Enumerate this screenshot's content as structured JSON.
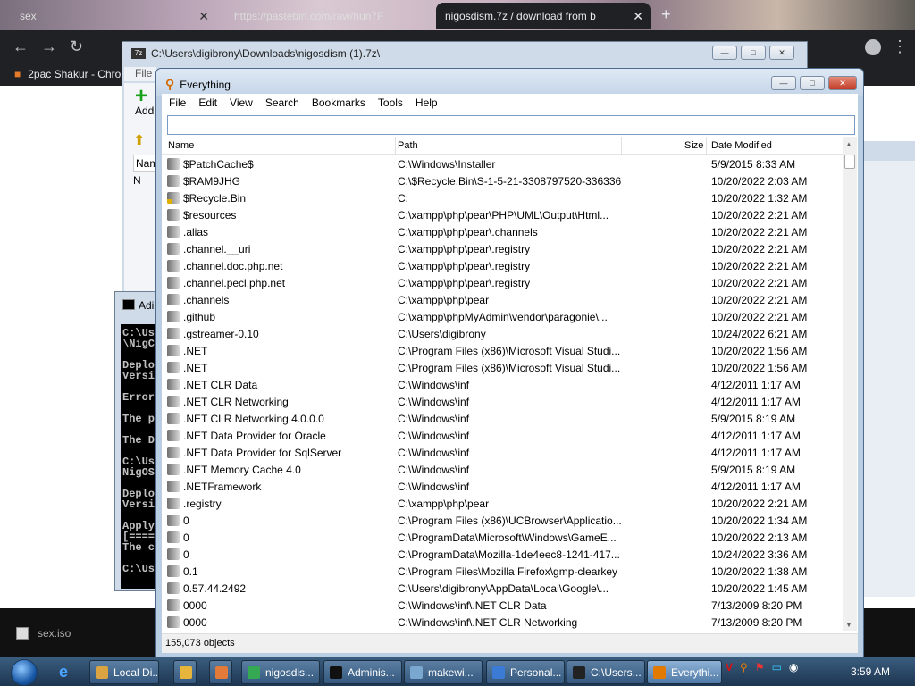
{
  "browser": {
    "tabs": [
      {
        "label": "sex"
      },
      {
        "label": "https://pastebin.com/raw/hun7F"
      },
      {
        "label": "nigosdism.7z / download from b"
      }
    ],
    "bookmark": "2pac Shakur - Chro"
  },
  "desktop": {
    "iso_file": "sex.iso"
  },
  "win7z": {
    "title": "C:\\Users\\digibrony\\Downloads\\nigosdism (1).7z\\",
    "menu_file": "File",
    "add_label": "Add",
    "name_col": "Nam",
    "item": "N"
  },
  "cmd": {
    "title": "Adi",
    "lines": "C:\\Us\n\\NigC\n\nDeplo\nVersi\n\nError\n\nThe p\n\nThe D\n\nC:\\Us\nNigOS\n\nDeplo\nVersi\n\nApply\n[====\nThe c\n\nC:\\Us"
  },
  "everything": {
    "title": "Everything",
    "menu": [
      "File",
      "Edit",
      "View",
      "Search",
      "Bookmarks",
      "Tools",
      "Help"
    ],
    "search_value": "",
    "columns": {
      "name": "Name",
      "path": "Path",
      "size": "Size",
      "date": "Date Modified"
    },
    "rows": [
      {
        "name": "$PatchCache$",
        "path": "C:\\Windows\\Installer",
        "date": "5/9/2015 8:33 AM"
      },
      {
        "name": "$RAM9JHG",
        "path": "C:\\$Recycle.Bin\\S-1-5-21-3308797520-336336...",
        "date": "10/20/2022 2:03 AM"
      },
      {
        "name": "$Recycle.Bin",
        "path": "C:",
        "date": "10/20/2022 1:32 AM",
        "lock": true
      },
      {
        "name": "$resources",
        "path": "C:\\xampp\\php\\pear\\PHP\\UML\\Output\\Html...",
        "date": "10/20/2022 2:21 AM"
      },
      {
        "name": ".alias",
        "path": "C:\\xampp\\php\\pear\\.channels",
        "date": "10/20/2022 2:21 AM"
      },
      {
        "name": ".channel.__uri",
        "path": "C:\\xampp\\php\\pear\\.registry",
        "date": "10/20/2022 2:21 AM"
      },
      {
        "name": ".channel.doc.php.net",
        "path": "C:\\xampp\\php\\pear\\.registry",
        "date": "10/20/2022 2:21 AM"
      },
      {
        "name": ".channel.pecl.php.net",
        "path": "C:\\xampp\\php\\pear\\.registry",
        "date": "10/20/2022 2:21 AM"
      },
      {
        "name": ".channels",
        "path": "C:\\xampp\\php\\pear",
        "date": "10/20/2022 2:21 AM"
      },
      {
        "name": ".github",
        "path": "C:\\xampp\\phpMyAdmin\\vendor\\paragonie\\...",
        "date": "10/20/2022 2:21 AM"
      },
      {
        "name": ".gstreamer-0.10",
        "path": "C:\\Users\\digibrony",
        "date": "10/24/2022 6:21 AM"
      },
      {
        "name": ".NET",
        "path": "C:\\Program Files (x86)\\Microsoft Visual Studi...",
        "date": "10/20/2022 1:56 AM"
      },
      {
        "name": ".NET",
        "path": "C:\\Program Files (x86)\\Microsoft Visual Studi...",
        "date": "10/20/2022 1:56 AM"
      },
      {
        "name": ".NET CLR Data",
        "path": "C:\\Windows\\inf",
        "date": "4/12/2011 1:17 AM"
      },
      {
        "name": ".NET CLR Networking",
        "path": "C:\\Windows\\inf",
        "date": "4/12/2011 1:17 AM"
      },
      {
        "name": ".NET CLR Networking 4.0.0.0",
        "path": "C:\\Windows\\inf",
        "date": "5/9/2015 8:19 AM"
      },
      {
        "name": ".NET Data Provider for Oracle",
        "path": "C:\\Windows\\inf",
        "date": "4/12/2011 1:17 AM"
      },
      {
        "name": ".NET Data Provider for SqlServer",
        "path": "C:\\Windows\\inf",
        "date": "4/12/2011 1:17 AM"
      },
      {
        "name": ".NET Memory Cache 4.0",
        "path": "C:\\Windows\\inf",
        "date": "5/9/2015 8:19 AM"
      },
      {
        "name": ".NETFramework",
        "path": "C:\\Windows\\inf",
        "date": "4/12/2011 1:17 AM"
      },
      {
        "name": ".registry",
        "path": "C:\\xampp\\php\\pear",
        "date": "10/20/2022 2:21 AM"
      },
      {
        "name": "0",
        "path": "C:\\Program Files (x86)\\UCBrowser\\Applicatio...",
        "date": "10/20/2022 1:34 AM"
      },
      {
        "name": "0",
        "path": "C:\\ProgramData\\Microsoft\\Windows\\GameE...",
        "date": "10/20/2022 2:13 AM"
      },
      {
        "name": "0",
        "path": "C:\\ProgramData\\Mozilla-1de4eec8-1241-417...",
        "date": "10/24/2022 3:36 AM"
      },
      {
        "name": "0.1",
        "path": "C:\\Program Files\\Mozilla Firefox\\gmp-clearkey",
        "date": "10/20/2022 1:38 AM"
      },
      {
        "name": "0.57.44.2492",
        "path": "C:\\Users\\digibrony\\AppData\\Local\\Google\\...",
        "date": "10/20/2022 1:45 AM"
      },
      {
        "name": "0000",
        "path": "C:\\Windows\\inf\\.NET CLR Data",
        "date": "7/13/2009 8:20 PM"
      },
      {
        "name": "0000",
        "path": "C:\\Windows\\inf\\.NET CLR Networking",
        "date": "7/13/2009 8:20 PM"
      }
    ],
    "status": "155,073 objects"
  },
  "taskbar": {
    "items": [
      {
        "label": "Local Di...",
        "icon_color": "#d9a441"
      },
      {
        "label": "",
        "icon_color": "#e7b53b"
      },
      {
        "label": "",
        "icon_color": "#e27a3a"
      },
      {
        "label": "nigosdis...",
        "icon_color": "#34a853"
      },
      {
        "label": "Adminis...",
        "icon_color": "#111111"
      },
      {
        "label": "makewi...",
        "icon_color": "#7aa7cf"
      },
      {
        "label": "Personal...",
        "icon_color": "#3b7bd5"
      },
      {
        "label": "C:\\Users...",
        "icon_color": "#222222"
      },
      {
        "label": "Everythi...",
        "icon_color": "#e27a00"
      }
    ],
    "clock": "3:59 AM"
  },
  "colors": {
    "accent": "#2f5b86",
    "titlebar": "#c4d5e8"
  }
}
